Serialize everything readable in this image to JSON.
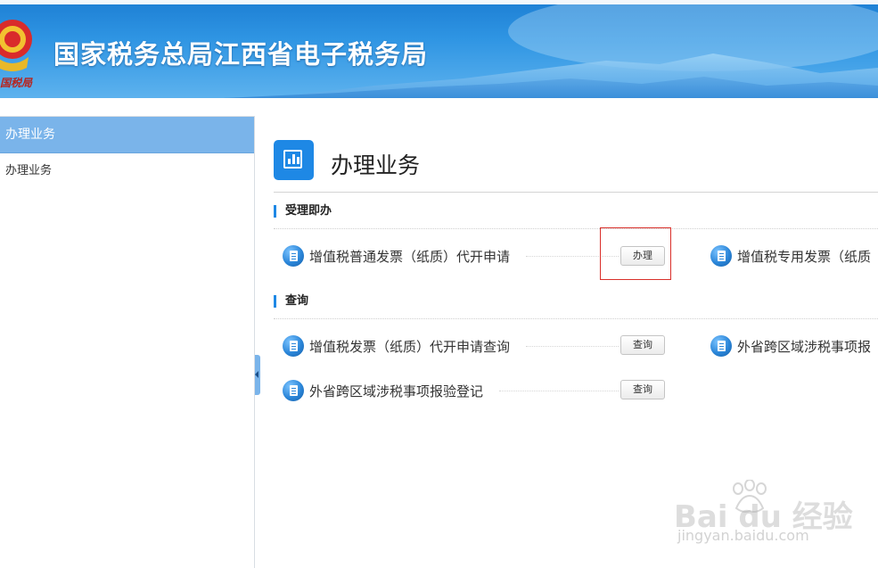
{
  "header": {
    "site_title": "国家税务总局江西省电子税务局",
    "emblem_signature": "国税局"
  },
  "sidebar": {
    "heading": "办理业务",
    "items": [
      {
        "label": "办理业务"
      }
    ]
  },
  "main": {
    "page_title": "办理业务",
    "sections": [
      {
        "title": "受理即办",
        "services": [
          {
            "label": "增值税普通发票（纸质）代开申请",
            "action": "办理"
          },
          {
            "label": "增值税专用发票（纸质"
          }
        ]
      },
      {
        "title": "查询",
        "services": [
          {
            "label": "增值税发票（纸质）代开申请查询",
            "action": "查询"
          },
          {
            "label": "外省跨区域涉税事项报"
          },
          {
            "label": "外省跨区域涉税事项报验登记",
            "action": "查询"
          }
        ]
      }
    ]
  },
  "watermark": {
    "brand": "Bai du 经验",
    "url": "jingyan.baidu.com"
  },
  "colors": {
    "header_blue": "#2f95e3",
    "sidebar_active": "#7ab4ea",
    "accent": "#1e88e5",
    "highlight_red": "#d9302b"
  }
}
